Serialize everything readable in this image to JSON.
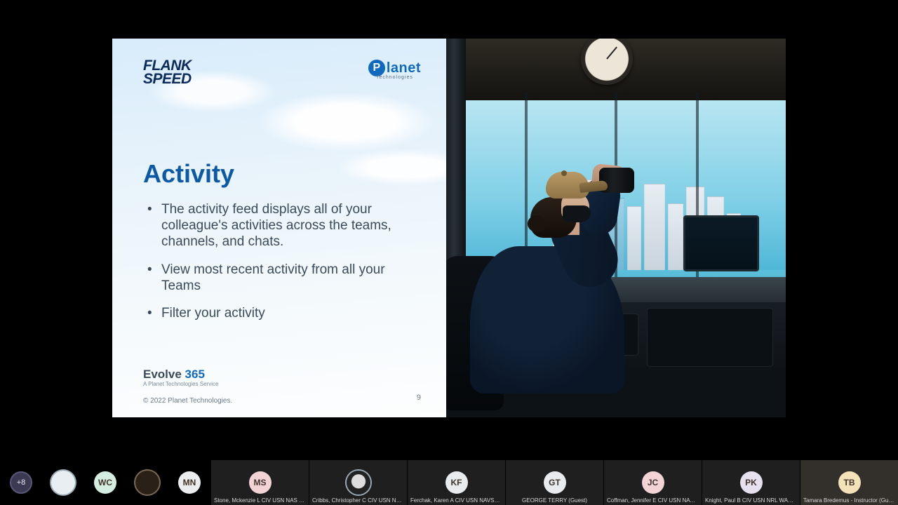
{
  "slide": {
    "brand_left_line1": "FLANK",
    "brand_left_line2": "SPEED",
    "brand_right_name": "lanet",
    "brand_right_sub": "Technologies",
    "title": "Activity",
    "bullets": [
      "The activity feed displays all of your colleague's activities across the teams, channels, and chats.",
      "View most recent activity from all your Teams",
      "Filter your activity"
    ],
    "footer_brand_a": "Evolve ",
    "footer_brand_b": "365",
    "footer_brand_sub": "A Planet Technologies Service",
    "copyright": "© 2022 Planet Technologies.",
    "page_number": "9"
  },
  "overflow_badge": "+8",
  "mini_participants": [
    {
      "kind": "image",
      "style": "light",
      "alt": "participant-avatar-1"
    },
    {
      "kind": "initials",
      "initials": "WC",
      "bg": "#d5ece1"
    },
    {
      "kind": "image",
      "style": "dark",
      "alt": "flank-speed-avatar"
    },
    {
      "kind": "initials",
      "initials": "MN",
      "bg": "#ecedee"
    }
  ],
  "tiles": [
    {
      "initials": "MS",
      "bg": "#f3d3d6",
      "name": "Stone, Mckenzie L CIV USN NAS PA..."
    },
    {
      "kind": "eagle",
      "name": "Cribbs, Christopher C CIV USN NAV..."
    },
    {
      "initials": "KF",
      "bg": "#e8ecef",
      "name": "Ferchak, Karen A CIV USN NAVSUP..."
    },
    {
      "initials": "GT",
      "bg": "#e8ecef",
      "name": "GEORGE TERRY (Guest)"
    },
    {
      "initials": "JC",
      "bg": "#f3d3d6",
      "name": "Coffman, Jennifer E CIV USN NAVF..."
    },
    {
      "initials": "PK",
      "bg": "#e6e0ef",
      "name": "Knight, Paul B CIV USN NRL WASHI..."
    },
    {
      "initials": "TB",
      "bg": "#f4e2b8",
      "name": "Tamara Bredemus - Instructor (Guest)",
      "presenter": true
    }
  ]
}
